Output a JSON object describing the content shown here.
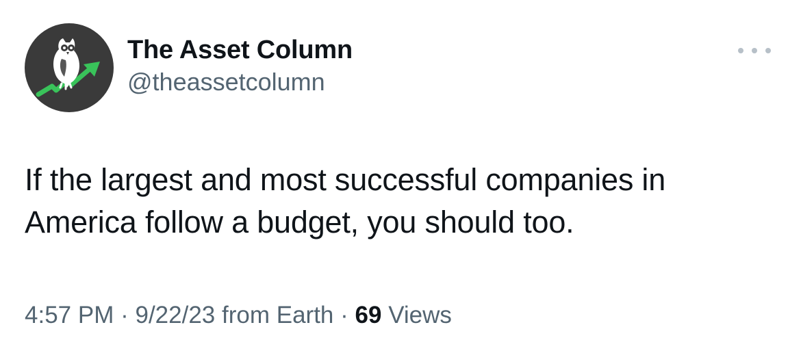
{
  "author": {
    "display_name": "The Asset Column",
    "handle": "@theassetcolumn",
    "avatar_icon": "owl-on-rising-arrow-logo",
    "avatar_bg": "#3a3a3a",
    "accent": "#39c35a"
  },
  "menu": {
    "icon": "more-options-icon"
  },
  "tweet": {
    "text_line1": "If the largest and most successful companies in",
    "text_line2": "America follow a budget, you should too."
  },
  "meta": {
    "time": "4:57 PM",
    "separator": "·",
    "date": "9/22/23",
    "source": "from Earth",
    "views_count": "69",
    "views_label": "Views"
  }
}
